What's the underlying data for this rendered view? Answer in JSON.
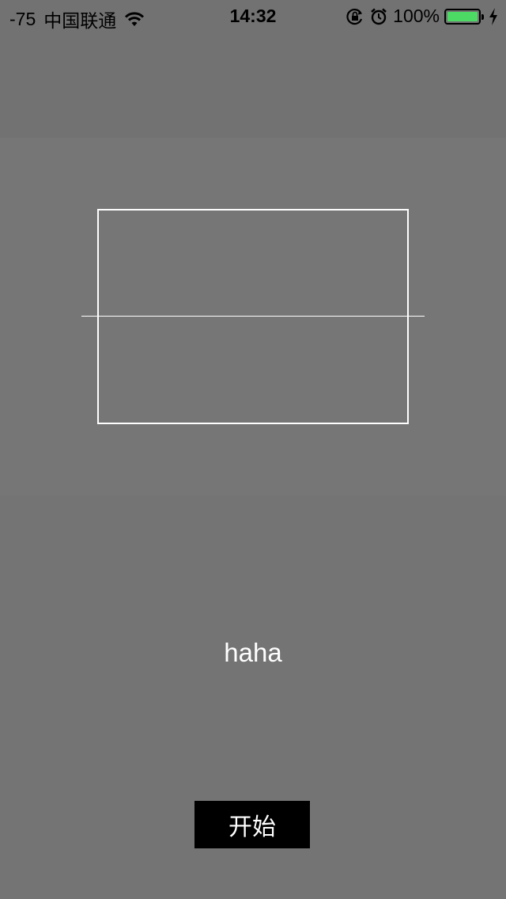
{
  "status_bar": {
    "signal": "-75",
    "carrier": "中国联通",
    "time": "14:32",
    "battery_text": "100%",
    "battery_level": 1.0,
    "icons": [
      "wifi-icon",
      "rotation-lock-icon",
      "alarm-icon",
      "battery-icon",
      "charging-bolt-icon"
    ]
  },
  "main": {
    "result_text": "haha",
    "start_label": "开始"
  },
  "colors": {
    "background": "#747474",
    "frame": "#ffffff",
    "button_bg": "#000000",
    "battery_fill": "#4cd964"
  }
}
